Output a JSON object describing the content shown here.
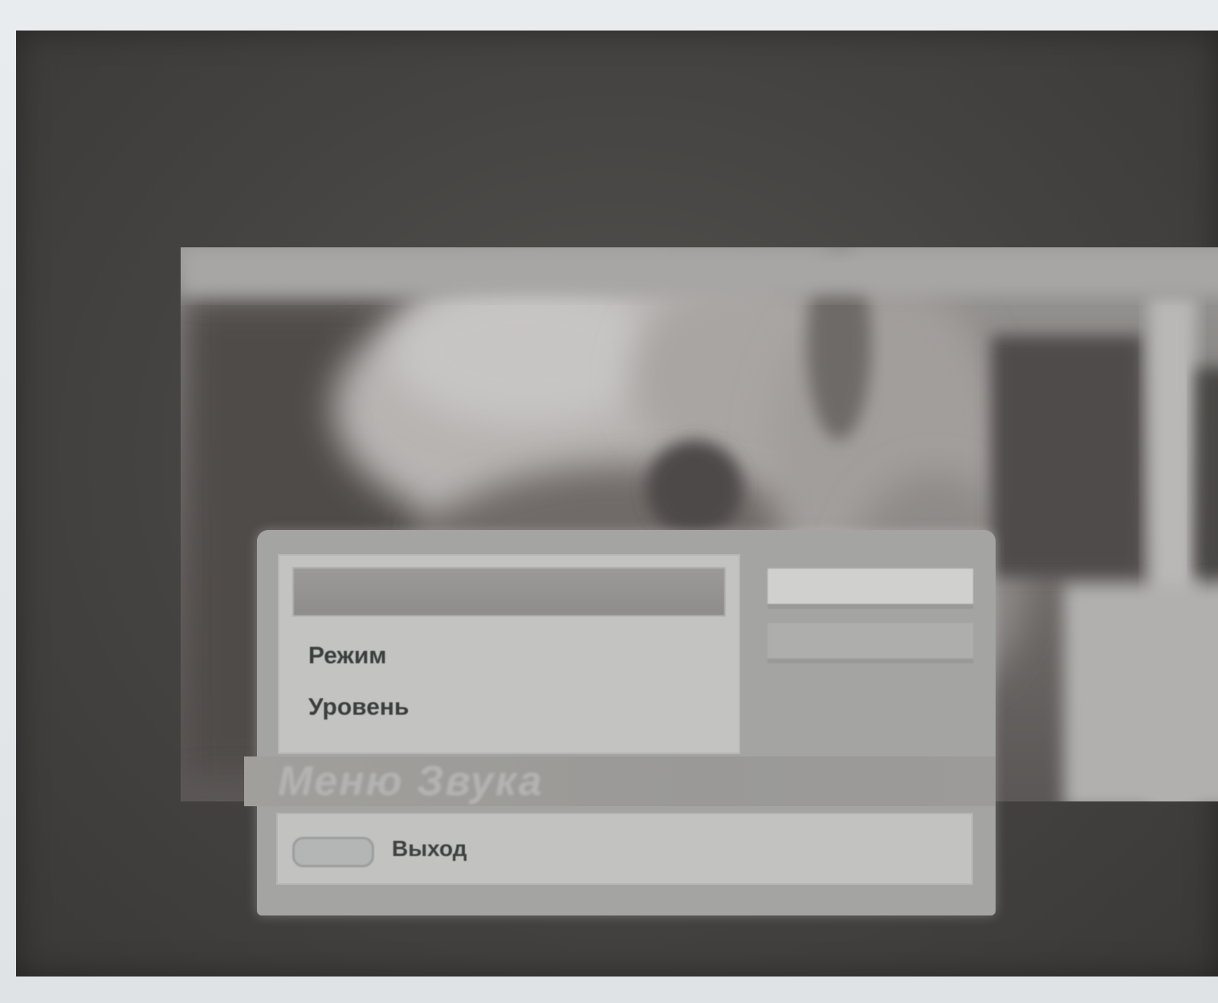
{
  "osd_menu": {
    "title": "Меню Звука",
    "items": [
      {
        "label": "",
        "selected": true
      },
      {
        "label": "Режим",
        "selected": false
      },
      {
        "label": "Уровень",
        "selected": false
      }
    ],
    "values": [
      "",
      "",
      ""
    ],
    "footer": {
      "exit_key_icon": "remote-button-icon",
      "exit_label": "Выход"
    }
  },
  "colors": {
    "menu_background": "#a4a4a2",
    "list_background": "#c3c4c2",
    "selection_highlight": "#9c9a99",
    "screen_background": "#454341"
  }
}
